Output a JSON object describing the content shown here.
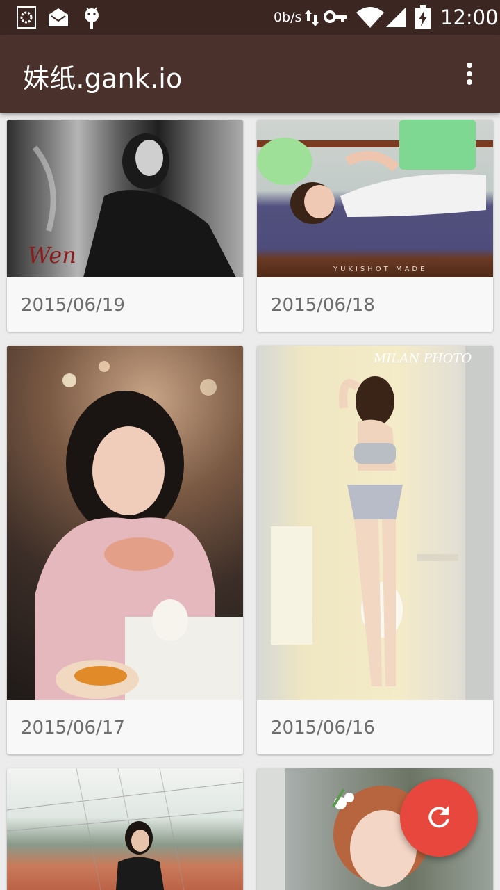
{
  "status_bar": {
    "net_speed": "0b/s",
    "time": "12:00",
    "icons": [
      "gallery-app-icon",
      "mail-icon",
      "android-debug-icon",
      "data-arrows-icon",
      "vpn-key-icon",
      "wifi-icon",
      "signal-icon",
      "battery-charging-icon"
    ]
  },
  "app_bar": {
    "title": "妹纸.gank.io",
    "overflow_icon": "more-vert-icon"
  },
  "cards": [
    {
      "date": "2015/06/19"
    },
    {
      "date": "2015/06/18"
    },
    {
      "date": "2015/06/17"
    },
    {
      "date": "2015/06/16"
    },
    {
      "date": ""
    },
    {
      "date": ""
    }
  ],
  "photo_overlays": {
    "card1_signature": "Wen",
    "card2_watermark": "YUKISHOT MADE",
    "card4_watermark": "MILAN PHOTO"
  },
  "fab": {
    "icon": "refresh-icon",
    "color": "#e8473d"
  },
  "colors": {
    "app_bar": "#4a312c",
    "status_bar": "#3b2622",
    "background": "#ececec"
  }
}
